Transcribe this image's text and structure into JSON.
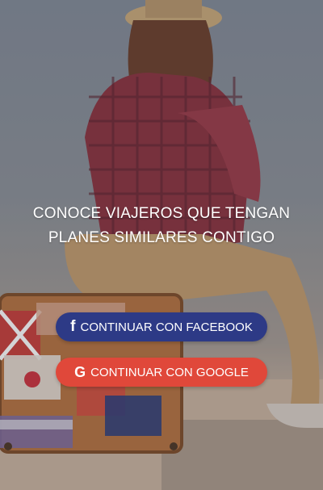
{
  "headline": {
    "line1": "CONOCE VIAJEROS QUE TENGAN",
    "line2": "PLANES SIMILARES CONTIGO"
  },
  "buttons": {
    "facebook": {
      "label": "CONTINUAR CON FACEBOOK",
      "icon": "f",
      "icon_name": "facebook-icon",
      "color": "#2d3a86"
    },
    "google": {
      "label": "CONTINUAR CON GOOGLE",
      "icon": "G",
      "icon_name": "google-icon",
      "color": "#e0483a"
    }
  }
}
